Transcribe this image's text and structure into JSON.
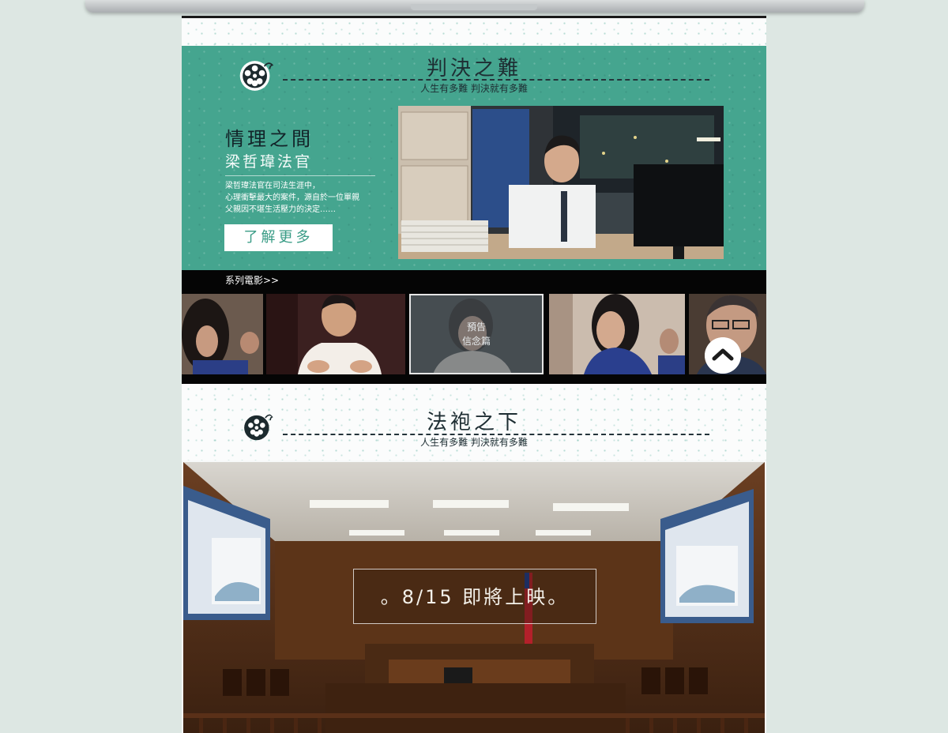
{
  "section1": {
    "title": "判決之難",
    "tagline": "人生有多難 判決就有多難"
  },
  "feature": {
    "title": "情理之間",
    "subtitle": "梁哲瑋法官",
    "description_lines": [
      "梁哲瑋法官在司法生涯中，",
      "心理衝擊最大的案件，源自於一位單親",
      "父親因不堪生活壓力的決定……"
    ],
    "button_label": "了解更多"
  },
  "series": {
    "label": "系列電影>>",
    "thumbnails": [
      {
        "name": "thumb-1"
      },
      {
        "name": "thumb-2"
      },
      {
        "name": "thumb-3",
        "overlay_line1": "預告",
        "overlay_line2": "信念篇"
      },
      {
        "name": "thumb-4"
      },
      {
        "name": "thumb-5"
      }
    ]
  },
  "section2": {
    "title": "法袍之下",
    "tagline": "人生有多難 判決就有多難"
  },
  "release": {
    "text": "。8/15 即將上映。"
  },
  "colors": {
    "teal": "#45a58f",
    "dark": "#1e2e33",
    "white": "#ffffff"
  },
  "icons": [
    "film-reel-icon",
    "chevron-up-icon"
  ]
}
